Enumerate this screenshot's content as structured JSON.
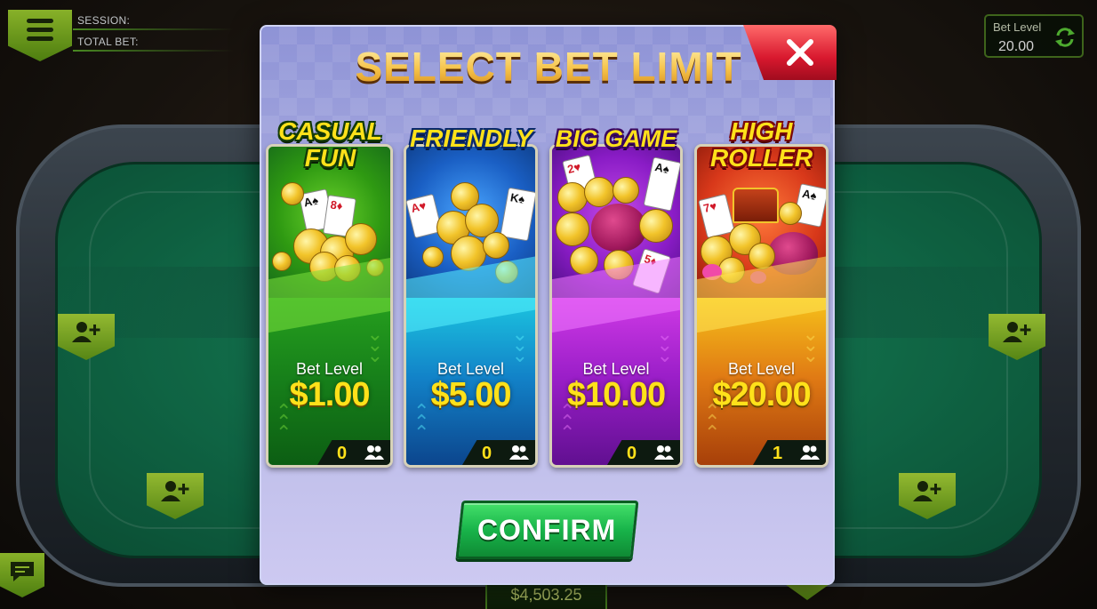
{
  "hud": {
    "session_label": "SESSION:",
    "total_bet_label": "TOTAL BET:",
    "bet_level_label": "Bet Level",
    "bet_level_value": "20.00",
    "pot_amount": "$4,503.25"
  },
  "modal": {
    "title": "SELECT BET LIMIT",
    "confirm_label": "CONFIRM",
    "bet_level_label": "Bet Level",
    "cards": [
      {
        "title_line1": "CASUAL",
        "title_line2": "FUN",
        "value": "$1.00",
        "players": "0",
        "theme": "green"
      },
      {
        "title_line1": "FRIENDLY",
        "title_line2": "",
        "value": "$5.00",
        "players": "0",
        "theme": "blue"
      },
      {
        "title_line1": "BIG GAME",
        "title_line2": "",
        "value": "$10.00",
        "players": "0",
        "theme": "purple"
      },
      {
        "title_line1": "HIGH",
        "title_line2": "ROLLER",
        "value": "$20.00",
        "players": "1",
        "theme": "orange"
      }
    ]
  },
  "colors": {
    "accent_green": "#6aa41a",
    "gold_text": "#ffe11a",
    "close_red": "#d8182e",
    "modal_bg": "#a9abe0"
  },
  "icons": [
    "menu-icon",
    "refresh-icon",
    "add-player-icon",
    "chat-icon",
    "close-icon",
    "players-icon"
  ]
}
